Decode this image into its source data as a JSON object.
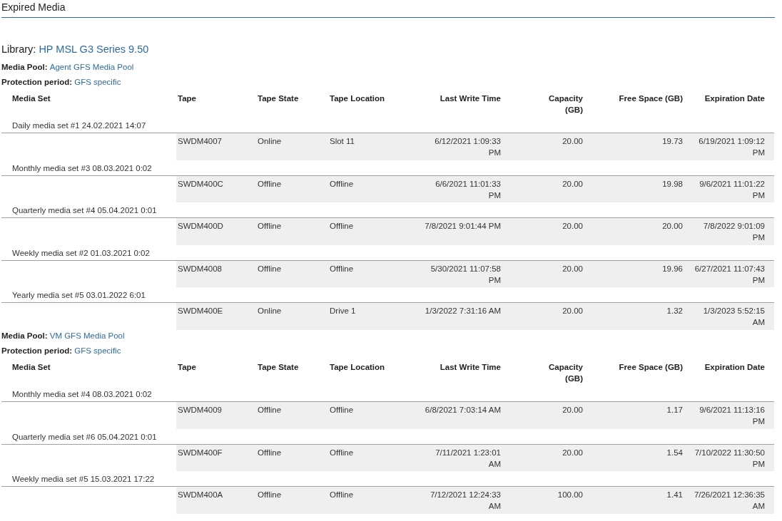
{
  "title": "Expired Media",
  "library": {
    "label": "Library:",
    "name": "HP MSL G3 Series 9.50"
  },
  "pools": [
    {
      "pool_label": "Media Pool:",
      "pool_name": "Agent GFS Media Pool",
      "period_label": "Protection period:",
      "period": "GFS specific",
      "columns": [
        "Media Set",
        "Tape",
        "Tape State",
        "Tape Location",
        "Last Write Time",
        "Capacity (GB)",
        "Free Space (GB)",
        "Expiration Date"
      ],
      "groups": [
        {
          "media_set": "Daily media set #1 24.02.2021 14:07",
          "tapes": [
            {
              "tape": "SWDM4007",
              "state": "Online",
              "location": "Slot 11",
              "last_write": "6/12/2021 1:09:33 PM",
              "capacity": "20.00",
              "free": "19.73",
              "expiration": "6/19/2021 1:09:12 PM"
            }
          ]
        },
        {
          "media_set": "Monthly media set #3 08.03.2021 0:02",
          "tapes": [
            {
              "tape": "SWDM400C",
              "state": "Offline",
              "location": "Offline",
              "last_write": "6/6/2021 11:01:33 PM",
              "capacity": "20.00",
              "free": "19.98",
              "expiration": "9/6/2021 11:01:22 PM"
            }
          ]
        },
        {
          "media_set": "Quarterly media set #4 05.04.2021 0:01",
          "tapes": [
            {
              "tape": "SWDM400D",
              "state": "Offline",
              "location": "Offline",
              "last_write": "7/8/2021 9:01:44 PM",
              "capacity": "20.00",
              "free": "20.00",
              "expiration": "7/8/2022 9:01:09 PM"
            }
          ]
        },
        {
          "media_set": "Weekly media set #2 01.03.2021 0:02",
          "tapes": [
            {
              "tape": "SWDM4008",
              "state": "Offline",
              "location": "Offline",
              "last_write": "5/30/2021 11:07:58 PM",
              "capacity": "20.00",
              "free": "19.96",
              "expiration": "6/27/2021 11:07:43 PM"
            }
          ]
        },
        {
          "media_set": "Yearly media set #5 03.01.2022 6:01",
          "tapes": [
            {
              "tape": "SWDM400E",
              "state": "Online",
              "location": "Drive 1",
              "last_write": "1/3/2022 7:31:16 AM",
              "capacity": "20.00",
              "free": "1.32",
              "expiration": "1/3/2023 5:52:15 AM"
            }
          ]
        }
      ]
    },
    {
      "pool_label": "Media Pool:",
      "pool_name": "VM GFS Media Pool",
      "period_label": "Protection period:",
      "period": "GFS specific",
      "columns": [
        "Media Set",
        "Tape",
        "Tape State",
        "Tape Location",
        "Last Write Time",
        "Capacity (GB)",
        "Free Space (GB)",
        "Expiration Date"
      ],
      "groups": [
        {
          "media_set": "Monthly media set #4 08.03.2021 0:02",
          "tapes": [
            {
              "tape": "SWDM4009",
              "state": "Offline",
              "location": "Offline",
              "last_write": "6/8/2021 7:03:14 AM",
              "capacity": "20.00",
              "free": "1.17",
              "expiration": "9/6/2021 11:13:16 PM"
            }
          ]
        },
        {
          "media_set": "Quarterly media set #6 05.04.2021 0:01",
          "tapes": [
            {
              "tape": "SWDM400F",
              "state": "Offline",
              "location": "Offline",
              "last_write": "7/11/2021 1:23:01 AM",
              "capacity": "20.00",
              "free": "1.54",
              "expiration": "7/10/2022 11:30:50 PM"
            }
          ]
        },
        {
          "media_set": "Weekly media set #5 15.03.2021 17:22",
          "tapes": [
            {
              "tape": "SWDM400A",
              "state": "Offline",
              "location": "Offline",
              "last_write": "7/12/2021 12:24:33 AM",
              "capacity": "100.00",
              "free": "1.41",
              "expiration": "7/26/2021 12:36:35 AM"
            }
          ]
        }
      ]
    }
  ]
}
